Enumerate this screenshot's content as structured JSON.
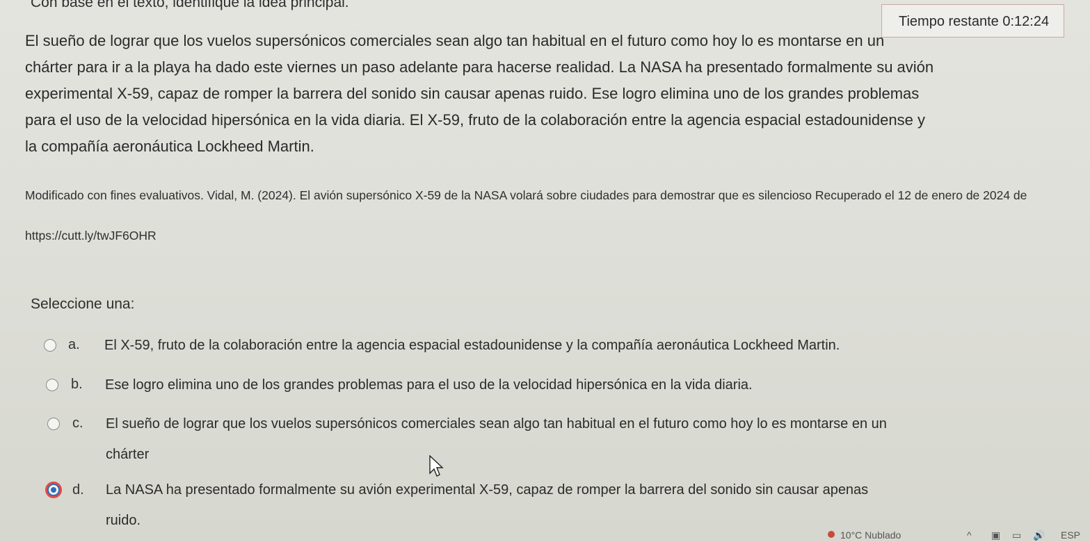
{
  "header": {
    "prompt": "Con base en el texto, identifique la idea principal.",
    "timer_label": "Tiempo restante",
    "timer_value": "0:12:24"
  },
  "passage": {
    "lines": [
      "El sueño de lograr que los vuelos supersónicos comerciales sean algo tan habitual en el futuro como hoy lo es montarse en un",
      "chárter para ir a la playa ha dado este viernes un paso adelante para hacerse realidad. La NASA ha presentado formalmente su avión",
      "experimental X-59, capaz de romper la barrera del sonido sin causar apenas ruido. Ese logro elimina uno de los grandes problemas",
      "para el uso de la velocidad hipersónica en la vida diaria. El X-59, fruto de la colaboración entre la agencia espacial estadounidense y",
      "la compañía aeronáutica Lockheed Martin."
    ]
  },
  "citation": {
    "lines": [
      "Modificado con fines evaluativos. Vidal, M. (2024). El avión supersónico X-59 de la NASA volará sobre ciudades para demostrar que es silencioso Recuperado el 12 de enero de 2024 de",
      "https://cutt.ly/twJF6OHR"
    ]
  },
  "question": {
    "select_label": "Seleccione una:",
    "options": [
      {
        "letter": "a.",
        "lines": [
          "El X-59, fruto de la colaboración entre la agencia espacial estadounidense y la compañía aeronáutica Lockheed Martin."
        ],
        "selected": false
      },
      {
        "letter": "b.",
        "lines": [
          "Ese logro elimina uno de los grandes problemas para el uso de la velocidad hipersónica en la vida diaria."
        ],
        "selected": false
      },
      {
        "letter": "c.",
        "lines": [
          "El sueño de lograr que los vuelos supersónicos comerciales sean algo tan habitual en el futuro como hoy lo es montarse en un",
          "chárter"
        ],
        "selected": false
      },
      {
        "letter": "d.",
        "lines": [
          "La NASA ha presentado formalmente su avión experimental X-59, capaz de romper la barrera del sonido sin causar apenas",
          "ruido."
        ],
        "selected": true
      }
    ]
  },
  "taskbar": {
    "weather": "10°C Nublado",
    "language": "ESP"
  },
  "colors": {
    "selected_radio": "#2f6db5",
    "focus_ring": "#e24a4a",
    "timer_border": "#c8a8a8"
  }
}
